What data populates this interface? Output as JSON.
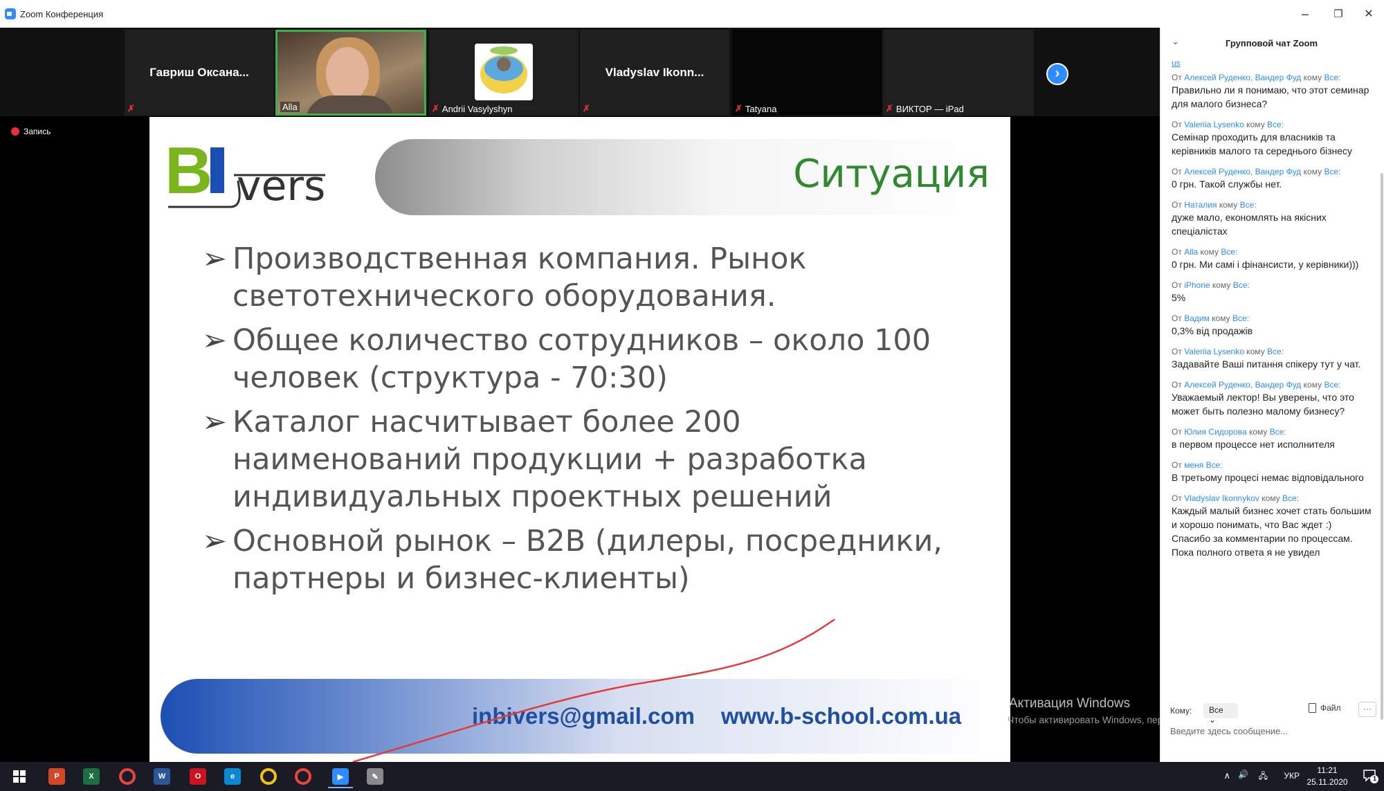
{
  "window": {
    "title": "Zoom Конференция",
    "minimize_glyph": "–",
    "restore_glyph": "❐",
    "close_glyph": "✕"
  },
  "participants": [
    {
      "big_name": "Гавриш  Оксана...",
      "label": ""
    },
    {
      "big_name": "",
      "label": "Alla"
    },
    {
      "big_name": "",
      "label": "Andrii Vasylyshyn"
    },
    {
      "big_name": "Vladyslav  Ikonn...",
      "label": ""
    },
    {
      "big_name": "",
      "label": "Tatyana"
    },
    {
      "big_name": "",
      "label": "ВИКТОР — iPad"
    }
  ],
  "recording": {
    "label": "Запись"
  },
  "slide": {
    "logo_text": "vers",
    "title": "Ситуация",
    "bullets": [
      "Производственная компания. Рынок светотехнического оборудования.",
      "Общее количество сотрудников – около 100 человек (структура - 70:30)",
      "Каталог насчитывает более 200 наименований продукции + разработка индивидуальных проектных решений",
      "Основной рынок – B2B (дилеры, посредники, партнеры и бизнес-клиенты)"
    ],
    "email": "inbivers@gmail.com",
    "website": "www.b-school.com.ua"
  },
  "watermark": {
    "line1": "Активация Windows",
    "line2": "Чтобы активировать Windows, перейдите в раздел \"Параметры\"."
  },
  "chat": {
    "title": "Групповой чат Zoom",
    "top_fragment": "us",
    "messages": [
      {
        "from_prefix": "От",
        "from": "Алексей Руденко, Вандер Фуд",
        "to_prefix": "кому",
        "to": "Все:",
        "text": "Правильно ли я понимаю, что этот семинар для малого бизнеса?"
      },
      {
        "from_prefix": "От",
        "from": "Valeriia Lysenko",
        "to_prefix": "кому",
        "to": "Все:",
        "text": "Семінар проходить для власників та керівників малого та середнього бізнесу"
      },
      {
        "from_prefix": "От",
        "from": "Алексей Руденко, Вандер Фуд",
        "to_prefix": "кому",
        "to": "Все:",
        "text": "0 грн. Такой службы нет."
      },
      {
        "from_prefix": "От",
        "from": "Наталия",
        "to_prefix": "кому",
        "to": "Все:",
        "text": "дуже мало, економлять на якісних спеціалістах"
      },
      {
        "from_prefix": "От",
        "from": "Alla",
        "to_prefix": "кому",
        "to": "Все:",
        "text": "0 грн. Ми самі і фінансисти, у керівники)))"
      },
      {
        "from_prefix": "От",
        "from": "iPhone",
        "to_prefix": "кому",
        "to": "Все:",
        "text": "5%"
      },
      {
        "from_prefix": "От",
        "from": "Вадим",
        "to_prefix": "кому",
        "to": "Все:",
        "text": "0,3% від продажів"
      },
      {
        "from_prefix": "От",
        "from": "Valeriia Lysenko",
        "to_prefix": "кому",
        "to": "Все:",
        "text": "Задавайте Ваші питання спікеру тут у чат."
      },
      {
        "from_prefix": "От",
        "from": "Алексей Руденко, Вандер Фуд",
        "to_prefix": "кому",
        "to": "Все:",
        "text": "Уважаемый лектор! Вы уверены, что это может быть полезно малому бизнесу?"
      },
      {
        "from_prefix": "От",
        "from": "Юлия Сидорова",
        "to_prefix": "кому",
        "to": "Все:",
        "text": "в первом процессе нет исполнителя"
      },
      {
        "from_prefix": "От",
        "from": "меня",
        "to_prefix": "",
        "to": "Все:",
        "text": "В третьому процесі немає відповідального"
      },
      {
        "from_prefix": "От",
        "from": "Vladyslav Ikonnykov",
        "to_prefix": "кому",
        "to": "Все:",
        "text": "Каждый малый бизнес хочет стать большим и хорошо понимать, что Вас ждет :)"
      },
      {
        "from_prefix": "",
        "from": "",
        "to_prefix": "",
        "to": "",
        "text": "Спасибо за комментарии по процессам. Пока полного ответа я не увидел"
      }
    ],
    "to_label": "Кому:",
    "to_value": "Все",
    "file_label": "Файл",
    "more_label": "···",
    "input_placeholder": "Введите здесь сообщение..."
  },
  "taskbar": {
    "start": "start-icon",
    "apps": [
      {
        "name": "powerpoint",
        "glyph": "P",
        "color": "#d24726"
      },
      {
        "name": "excel",
        "glyph": "X",
        "color": "#1d6f42"
      },
      {
        "name": "chrome",
        "glyph": "",
        "color": "#e8453c"
      },
      {
        "name": "word",
        "glyph": "W",
        "color": "#2b579a"
      },
      {
        "name": "opera",
        "glyph": "O",
        "color": "#cc1421"
      },
      {
        "name": "edge",
        "glyph": "e",
        "color": "#0c87d1"
      },
      {
        "name": "explorer",
        "glyph": "",
        "color": "#f4c20d"
      },
      {
        "name": "chrome2",
        "glyph": "",
        "color": "#e8453c"
      },
      {
        "name": "zoom",
        "glyph": "▶",
        "color": "#2d8cff"
      },
      {
        "name": "paint",
        "glyph": "✎",
        "color": "#8a8a8a"
      }
    ],
    "tray": {
      "lang": "УКР",
      "time": "11:21",
      "date": "25.11.2020",
      "notif_count": "1",
      "chevron": "∧",
      "volume": "🔊",
      "network": "🖧"
    }
  }
}
